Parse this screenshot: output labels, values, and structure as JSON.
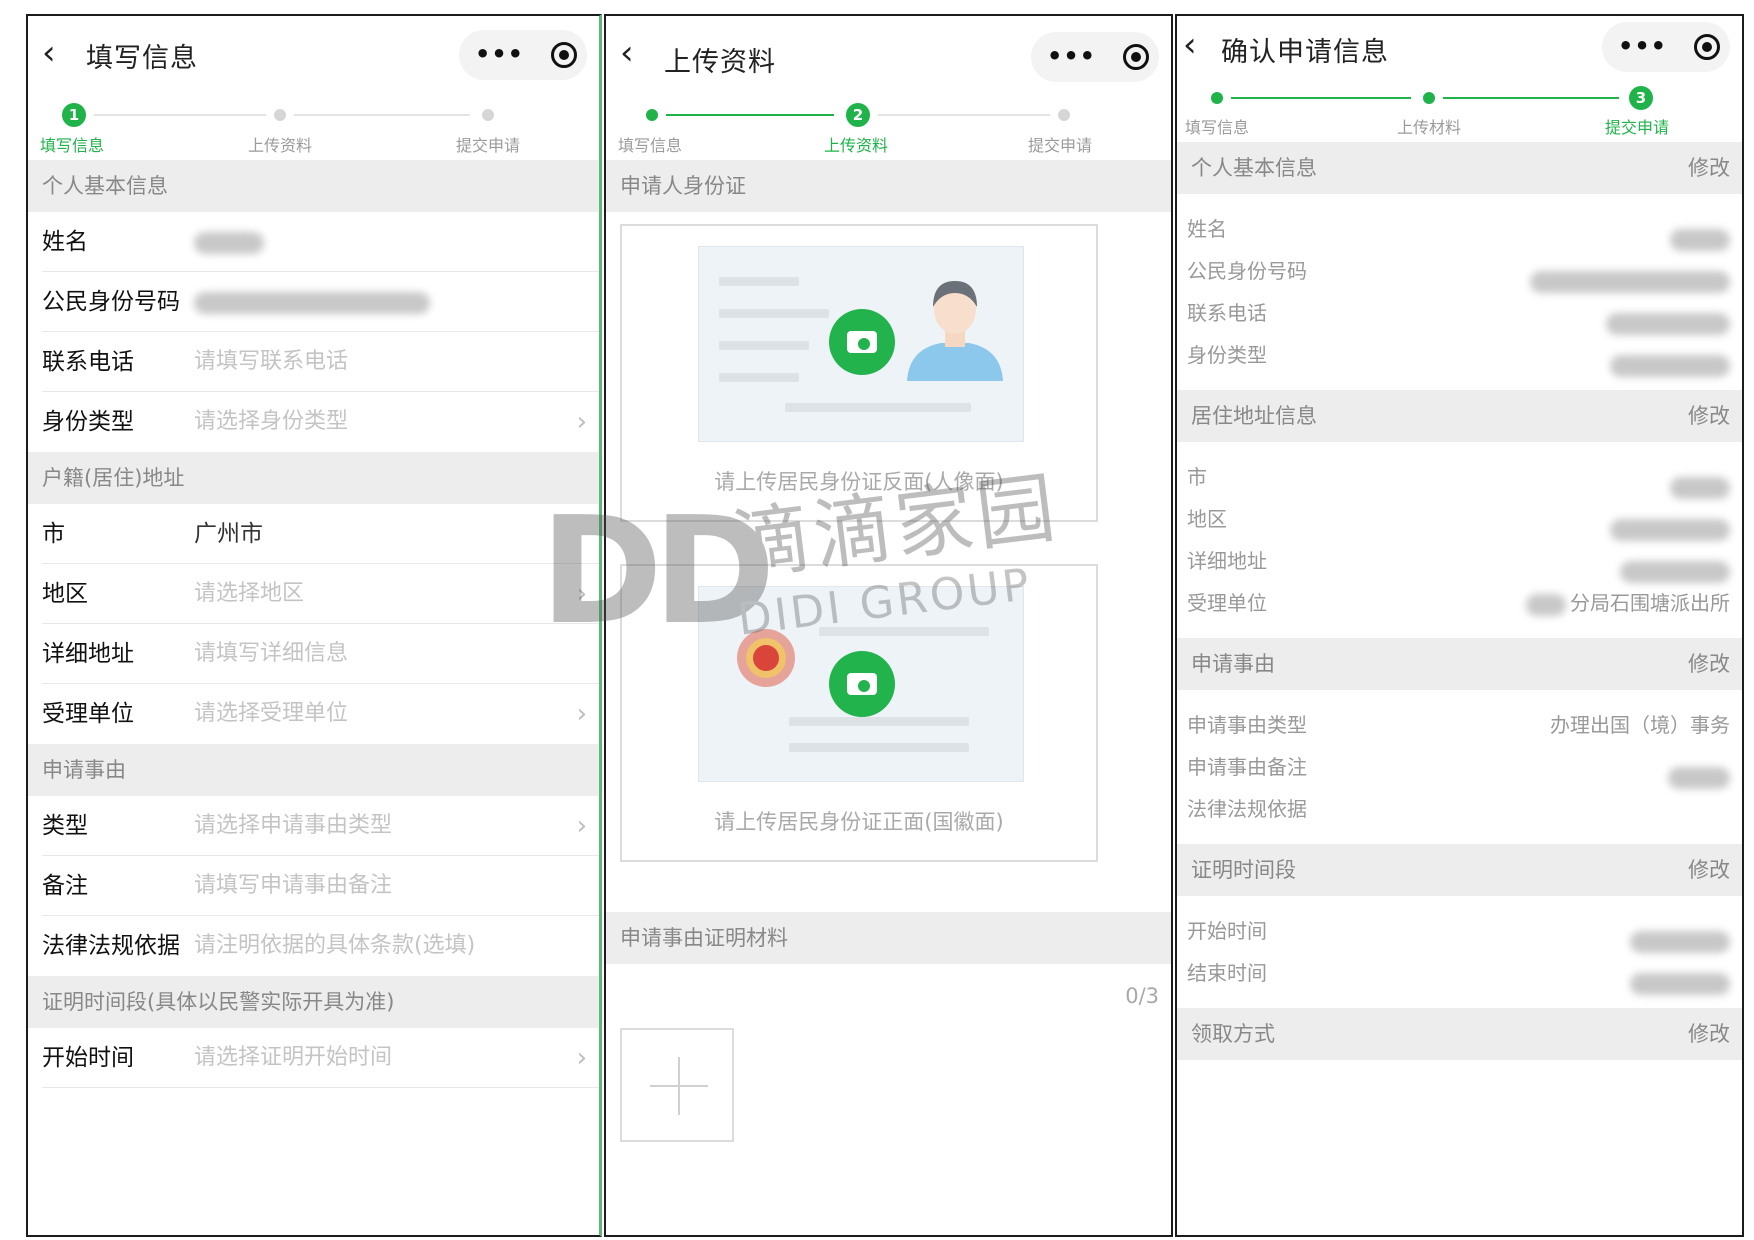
{
  "common": {
    "back_glyph": "‹",
    "capsule_dots": "•••",
    "chevron": "›",
    "plus": "+"
  },
  "steps": [
    "填写信息",
    "上传资料",
    "提交申请"
  ],
  "steps_p3": [
    "填写信息",
    "上传材料",
    "提交申请"
  ],
  "p1": {
    "title": "填写信息",
    "sections": {
      "basic": "个人基本信息",
      "address": "户籍(居住)地址",
      "reason": "申请事由",
      "period": "证明时间段(具体以民警实际开具为准)"
    },
    "rows": {
      "name": "姓名",
      "idno": "公民身份号码",
      "phone": "联系电话",
      "phone_ph": "请填写联系电话",
      "idtype": "身份类型",
      "idtype_ph": "请选择身份类型",
      "city": "市",
      "city_val": "广州市",
      "district": "地区",
      "district_ph": "请选择地区",
      "detail": "详细地址",
      "detail_ph": "请填写详细信息",
      "office": "受理单位",
      "office_ph": "请选择受理单位",
      "rtype": "类型",
      "rtype_ph": "请选择申请事由类型",
      "note": "备注",
      "note_ph": "请填写申请事由备注",
      "law": "法律法规依据",
      "law_ph": "请注明依据的具体条款(选填)",
      "start": "开始时间",
      "start_ph": "请选择证明开始时间"
    }
  },
  "p2": {
    "title": "上传资料",
    "section_id": "申请人身份证",
    "back_caption": "请上传居民身份证反面(人像面)",
    "front_caption": "请上传居民身份证正面(国徽面)",
    "section_material": "申请事由证明材料",
    "counter": "0/3"
  },
  "p3": {
    "title": "确认申请信息",
    "edit": "修改",
    "sections": {
      "basic": "个人基本信息",
      "address": "居住地址信息",
      "reason": "申请事由",
      "period": "证明时间段",
      "pickup": "领取方式"
    },
    "rows": {
      "name": "姓名",
      "idno": "公民身份号码",
      "phone": "联系电话",
      "idtype": "身份类型",
      "city": "市",
      "district": "地区",
      "detail": "详细地址",
      "office": "受理单位",
      "office_val": "分局石围塘派出所",
      "rtype": "申请事由类型",
      "rtype_val": "办理出国（境）事务",
      "note": "申请事由备注",
      "law": "法律法规依据",
      "start": "开始时间",
      "end": "结束时间"
    }
  },
  "watermark": {
    "logo": "DD",
    "cn": "滴滴家园",
    "en": "DIDI GROUP"
  },
  "colors": {
    "accent": "#1fb34a",
    "section_bg": "#ededed",
    "placeholder": "#c4c4c4"
  }
}
